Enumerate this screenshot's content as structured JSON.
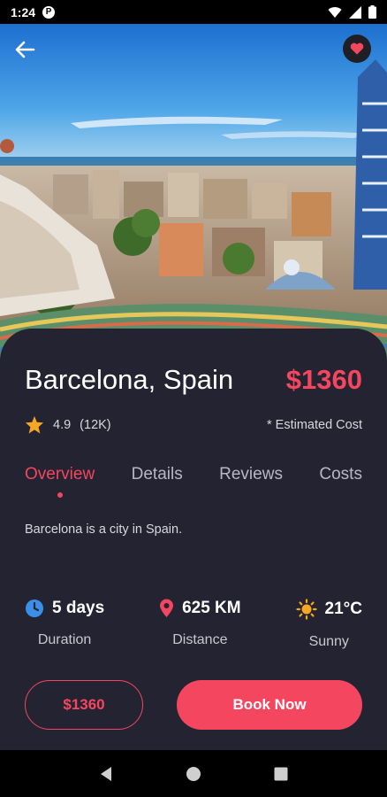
{
  "status_bar": {
    "time": "1:24",
    "app_icon": "P",
    "icons": [
      "wifi-icon",
      "cell-signal-icon",
      "battery-icon"
    ]
  },
  "header": {
    "back_icon": "arrow-left-icon",
    "favorite_icon": "heart-icon"
  },
  "destination": {
    "title": "Barcelona, Spain",
    "price": "$1360",
    "rating": "4.9",
    "reviews_count": "(12K)",
    "estimated_note": "* Estimated Cost"
  },
  "tabs": [
    {
      "label": "Overview",
      "active": true
    },
    {
      "label": "Details",
      "active": false
    },
    {
      "label": "Reviews",
      "active": false
    },
    {
      "label": "Costs",
      "active": false
    }
  ],
  "description": "Barcelona is a city in Spain.",
  "stats": [
    {
      "icon": "clock-icon",
      "value": "5 days",
      "label": "Duration"
    },
    {
      "icon": "location-pin-icon",
      "value": "625 KM",
      "label": "Distance"
    },
    {
      "icon": "sun-icon",
      "value": "21°C",
      "label": "Sunny"
    }
  ],
  "actions": {
    "price_button": "$1360",
    "book_button": "Book Now"
  },
  "colors": {
    "accent": "#f54660",
    "sheet_bg": "#232332",
    "stat_clock": "#3b8fe8",
    "stat_pin": "#f54660",
    "stat_sun": "#f5a623",
    "star": "#f5a623"
  },
  "nav_bar": [
    "back-triangle-icon",
    "home-circle-icon",
    "recents-square-icon"
  ]
}
